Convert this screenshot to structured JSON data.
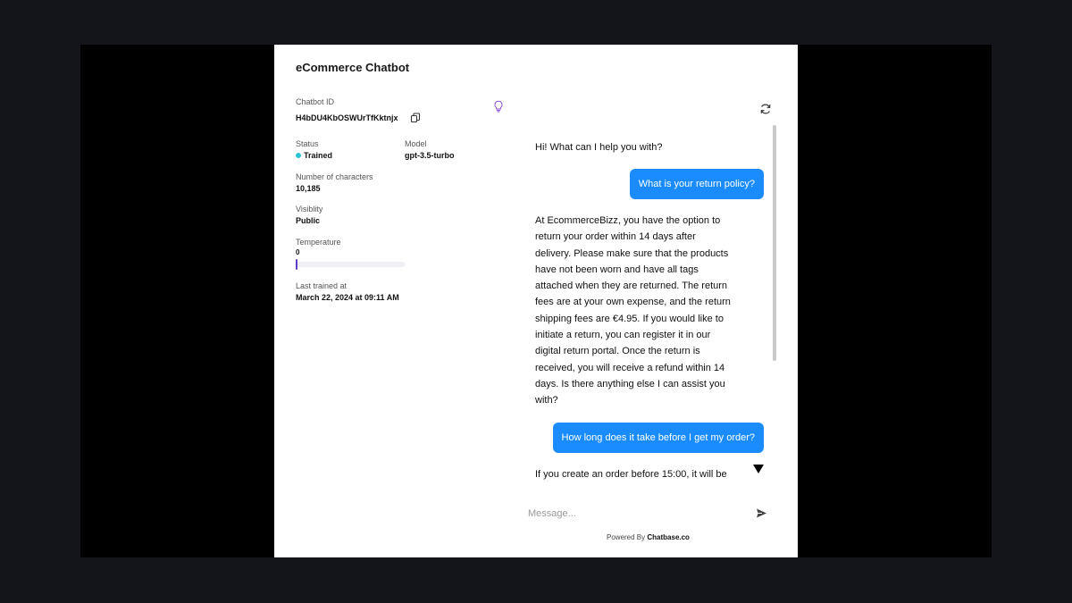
{
  "chatbot": {
    "title": "eCommerce Chatbot",
    "id_label": "Chatbot ID",
    "id_value": "H4bDU4KbOSWUrTfKktnjx",
    "status_label": "Status",
    "status_value": "Trained",
    "status_color": "#2ec4d6",
    "model_label": "Model",
    "model_value": "gpt-3.5-turbo",
    "chars_label": "Number of characters",
    "chars_value": "10,185",
    "visibility_label": "Visiblity",
    "visibility_value": "Public",
    "temperature_label": "Temperature",
    "temperature_value": "0",
    "temperature_level": 0,
    "last_trained_label": "Last trained at",
    "last_trained_value": "March 22, 2024 at 09:11 AM"
  },
  "icons": {
    "copy": "copy-icon",
    "bulb": "lightbulb-icon",
    "refresh": "refresh-icon",
    "scroll_down": "arrow-down-icon",
    "send": "send-icon"
  },
  "chat": {
    "greeting": "Hi! What can I help you with?",
    "user_1": "What is your return policy?",
    "bot_1_lines": [
      "At EcommerceBizz, you have the option to",
      "return your order within 14 days after",
      "delivery. Please make sure that the products",
      "have not been worn and have all tags",
      "attached when they are returned. The return",
      "fees are at your own expense, and the return",
      "shipping fees are €4.95. If you would like to",
      "initiate a return, you can register it in our",
      "digital return portal. Once the return is",
      "received, you will receive a refund within 14",
      "days. Is there anything else I can assist you",
      "with?"
    ],
    "user_2": "How long does it take before I get my order?",
    "bot_2_partial": "If you create an order before 15:00, it will be",
    "accent_color": "#1a8cff"
  },
  "composer": {
    "placeholder": "Message..."
  },
  "footer": {
    "powered_prefix": "Powered By",
    "powered_brand": "Chatbase.co"
  }
}
